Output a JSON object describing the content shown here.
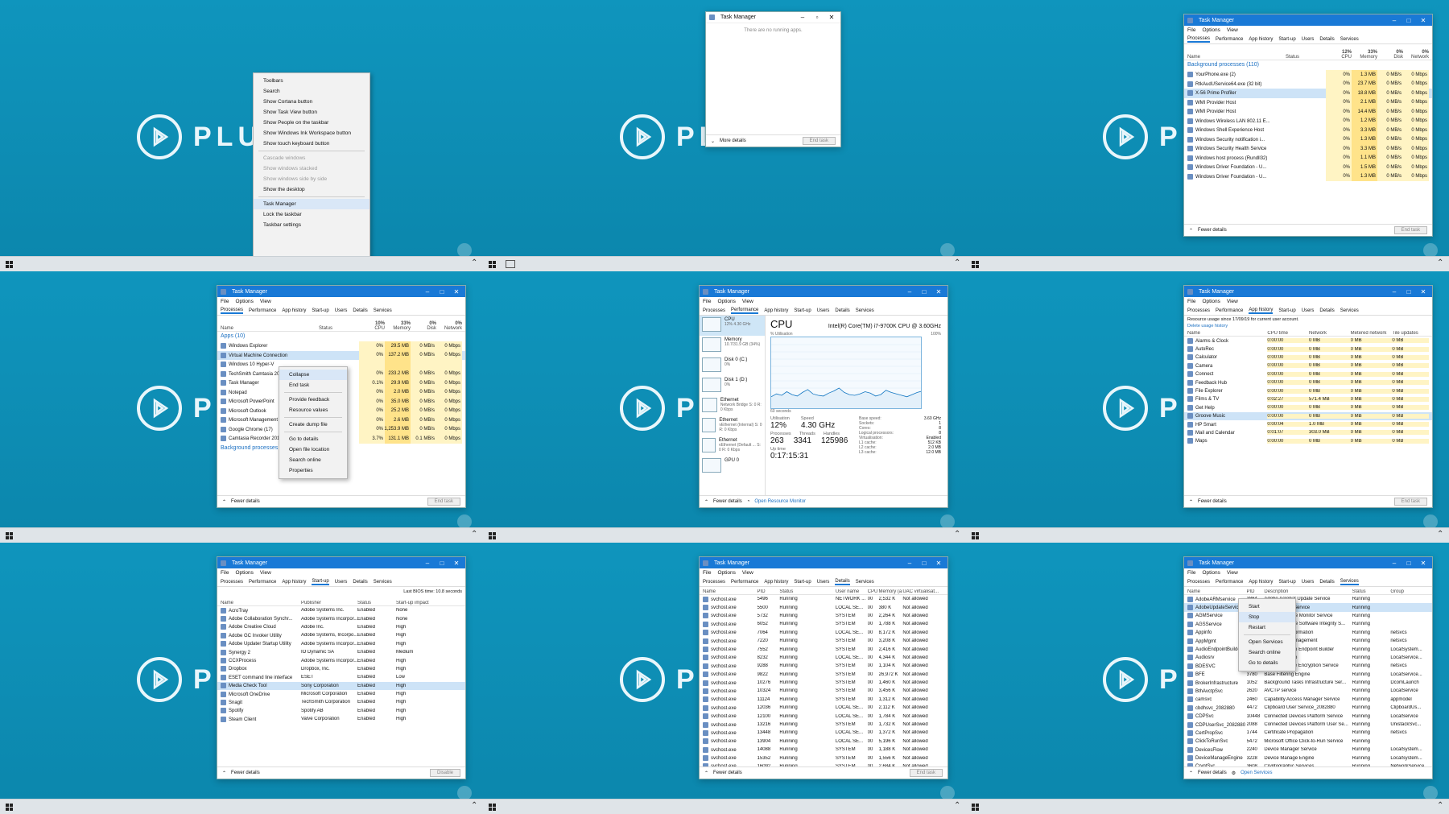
{
  "brand": {
    "text": "PLURALSIGHT",
    "short": "PL",
    "plura": "PLURA"
  },
  "taskbar_menu": {
    "items": [
      "Toolbars",
      "Search",
      "Show Cortana button",
      "Show Task View button",
      "Show People on the taskbar",
      "Show Windows Ink Workspace button",
      "Show touch keyboard button",
      "Cascade windows",
      "Show windows stacked",
      "Show windows side by side",
      "Show the desktop",
      "Task Manager",
      "Lock the taskbar",
      "Taskbar settings"
    ]
  },
  "tm_compact": {
    "title": "Task Manager",
    "empty": "There are no running apps.",
    "more": "More details",
    "end": "End task"
  },
  "tm": {
    "title": "Task Manager",
    "menu": [
      "File",
      "Options",
      "View"
    ],
    "tabs": [
      "Processes",
      "Performance",
      "App history",
      "Start-up",
      "Users",
      "Details",
      "Services"
    ],
    "fewer": "Fewer details",
    "end_task": "End task",
    "open_rm": "Open Resource Monitor",
    "open_services": "Open Services",
    "disable": "Disable"
  },
  "proc_bg": {
    "cols": {
      "name": "Name",
      "status": "Status",
      "cpu": "CPU",
      "mem": "Memory",
      "disk": "Disk",
      "net": "Network"
    },
    "pct": {
      "cpu": "12%",
      "mem": "33%",
      "disk": "0%",
      "net": "0%"
    },
    "section": "Background processes (110)",
    "rows": [
      [
        "YourPhone.exe (2)",
        "0%",
        "1.3 MB",
        "0 MB/s",
        "0 Mbps"
      ],
      [
        "RtkAudUService64.exe (32 bit)",
        "0%",
        "23.7 MB",
        "0 MB/s",
        "0 Mbps"
      ],
      [
        "X-56 Prime Profiler",
        "0%",
        "18.8 MB",
        "0 MB/s",
        "0 Mbps"
      ],
      [
        "WMI Provider Host",
        "0%",
        "2.1 MB",
        "0 MB/s",
        "0 Mbps"
      ],
      [
        "WMI Provider Host",
        "0%",
        "14.4 MB",
        "0 MB/s",
        "0 Mbps"
      ],
      [
        "Windows Wireless LAN 802.11 E...",
        "0%",
        "1.2 MB",
        "0 MB/s",
        "0 Mbps"
      ],
      [
        "Windows Shell Experience Host",
        "0%",
        "3.3 MB",
        "0 MB/s",
        "0 Mbps"
      ],
      [
        "Windows Security notification i...",
        "0%",
        "1.3 MB",
        "0 MB/s",
        "0 Mbps"
      ],
      [
        "Windows Security Health Service",
        "0%",
        "3.3 MB",
        "0 MB/s",
        "0 Mbps"
      ],
      [
        "Windows host process (Rundll32)",
        "0%",
        "1.1 MB",
        "0 MB/s",
        "0 Mbps"
      ],
      [
        "Windows Driver Foundation - U...",
        "0%",
        "1.5 MB",
        "0 MB/s",
        "0 Mbps"
      ],
      [
        "Windows Driver Foundation - U...",
        "0%",
        "1.3 MB",
        "0 MB/s",
        "0 Mbps"
      ]
    ]
  },
  "proc_apps": {
    "pct": {
      "cpu": "10%",
      "mem": "33%",
      "disk": "0%",
      "net": "0%"
    },
    "section": "Apps (10)",
    "section2": "Background processes (110)",
    "rows": [
      [
        "Windows Explorer",
        "0%",
        "29.5 MB",
        "0 MB/s",
        "0 Mbps"
      ],
      [
        "Virtual Machine Connection",
        "0%",
        "137.2 MB",
        "0 MB/s",
        "0 Mbps"
      ],
      [
        "Windows 10 Hyper-V",
        "",
        "",
        "",
        ""
      ],
      [
        "TechSmith Camtasia 2018",
        "0%",
        "233.2 MB",
        "0 MB/s",
        "0 Mbps"
      ],
      [
        "Task Manager",
        "0.1%",
        "29.9 MB",
        "0 MB/s",
        "0 Mbps"
      ],
      [
        "Notepad",
        "0%",
        "2.0 MB",
        "0 MB/s",
        "0 Mbps"
      ],
      [
        "Microsoft PowerPoint",
        "0%",
        "35.0 MB",
        "0 MB/s",
        "0 Mbps"
      ],
      [
        "Microsoft Outlook",
        "0%",
        "25.2 MB",
        "0 MB/s",
        "0 Mbps"
      ],
      [
        "Microsoft Management Console",
        "0%",
        "2.6 MB",
        "0 MB/s",
        "0 Mbps"
      ],
      [
        "Google Chrome (17)",
        "0%",
        "1,253.9 MB",
        "0 MB/s",
        "0 Mbps"
      ],
      [
        "Camtasia Recorder 2018",
        "3.7%",
        "131.1 MB",
        "0.1 MB/s",
        "0 Mbps"
      ]
    ],
    "ctx": [
      "Collapse",
      "End task",
      "Provide feedback",
      "Resource values",
      "Create dump file",
      "Go to details",
      "Open file location",
      "Search online",
      "Properties"
    ]
  },
  "perf": {
    "items": [
      {
        "name": "CPU",
        "sub": "12% 4.30 GHz"
      },
      {
        "name": "Memory",
        "sub": "10.7/31.9 GB (34%)"
      },
      {
        "name": "Disk 0 (C:)",
        "sub": "0%"
      },
      {
        "name": "Disk 1 (D:)",
        "sub": "0%"
      },
      {
        "name": "Ethernet",
        "sub": "Network Bridge S: 0 R: 0 Kbps"
      },
      {
        "name": "Ethernet",
        "sub": "vEthernet (Internal) S: 0 R: 0 Kbps"
      },
      {
        "name": "Ethernet",
        "sub": "vEthernet (Default ... S: 0 R: 0 Kbps"
      },
      {
        "name": "GPU 0",
        "sub": ""
      }
    ],
    "heading": "CPU",
    "cpu_name": "Intel(R) Core(TM) i7-9700K CPU @ 3.60GHz",
    "graph_label": "% Utilisation",
    "graph_max": "100%",
    "graph_time": "60 seconds",
    "util_label": "Utilisation",
    "util": "12%",
    "speed_label": "Speed",
    "speed": "4.30 GHz",
    "proc_label": "Processes",
    "proc": "263",
    "threads_label": "Threads",
    "threads": "3341",
    "handles_label": "Handles",
    "handles": "125986",
    "uptime_label": "Up time",
    "uptime": "0:17:15:31",
    "specs": [
      [
        "Base speed:",
        "3.60 GHz"
      ],
      [
        "Sockets:",
        "1"
      ],
      [
        "Cores:",
        "8"
      ],
      [
        "Logical processors:",
        "8"
      ],
      [
        "Virtualisation:",
        "Enabled"
      ],
      [
        "L1 cache:",
        "512 KB"
      ],
      [
        "L2 cache:",
        "2.0 MB"
      ],
      [
        "L3 cache:",
        "12.0 MB"
      ]
    ],
    "graph": [
      18,
      22,
      20,
      25,
      21,
      19,
      24,
      28,
      22,
      20,
      19,
      23,
      26,
      30,
      24,
      21,
      20,
      22,
      25,
      23,
      19,
      21,
      27,
      24,
      22,
      20,
      18,
      21,
      24,
      26
    ]
  },
  "apphist": {
    "note": "Resource usage since 17/09/19 for current user account.",
    "del": "Delete usage history",
    "cols": [
      "Name",
      "CPU time",
      "Network",
      "Metered network",
      "Tile updates"
    ],
    "rows": [
      [
        "Alarms & Clock",
        "0:00:00",
        "0 MB",
        "0 MB",
        "0 MB"
      ],
      [
        "AutoRec",
        "0:00:00",
        "0 MB",
        "0 MB",
        "0 MB"
      ],
      [
        "Calculator",
        "0:00:00",
        "0 MB",
        "0 MB",
        "0 MB"
      ],
      [
        "Camera",
        "0:00:00",
        "0 MB",
        "0 MB",
        "0 MB"
      ],
      [
        "Connect",
        "0:00:00",
        "0 MB",
        "0 MB",
        "0 MB"
      ],
      [
        "Feedback Hub",
        "0:00:00",
        "0 MB",
        "0 MB",
        "0 MB"
      ],
      [
        "File Explorer",
        "0:00:00",
        "0 MB",
        "0 MB",
        "0 MB"
      ],
      [
        "Films & TV",
        "0:02:27",
        "571.4 MB",
        "0 MB",
        "0 MB"
      ],
      [
        "Get Help",
        "0:00:00",
        "0 MB",
        "0 MB",
        "0 MB"
      ],
      [
        "Groove Music",
        "0:00:00",
        "0 MB",
        "0 MB",
        "0 MB"
      ],
      [
        "HP Smart",
        "0:00:04",
        "1.0 MB",
        "0 MB",
        "0 MB"
      ],
      [
        "Mail and Calendar",
        "0:01:07",
        "303.0 MB",
        "0 MB",
        "0 MB"
      ],
      [
        "Maps",
        "0:00:00",
        "0 MB",
        "0 MB",
        "0 MB"
      ]
    ]
  },
  "startup": {
    "note": "Last BIOS time: 10.8 seconds",
    "cols": [
      "Name",
      "Publisher",
      "Status",
      "Start-up impact"
    ],
    "rows": [
      [
        "AcroTray",
        "Adobe Systems Inc.",
        "Enabled",
        "None"
      ],
      [
        "Adobe Collaboration Synchr...",
        "Adobe Systems Incorpor...",
        "Enabled",
        "None"
      ],
      [
        "Adobe Creative Cloud",
        "Adobe Inc.",
        "Enabled",
        "High"
      ],
      [
        "Adobe GC Invoker Utility",
        "Adobe Systems, Incorpo...",
        "Enabled",
        "High"
      ],
      [
        "Adobe Updater Startup Utility",
        "Adobe Systems Incorpor...",
        "Enabled",
        "High"
      ],
      [
        "Synergy 2",
        "IO Dynamic SA",
        "Enabled",
        "Medium"
      ],
      [
        "CCXProcess",
        "Adobe Systems Incorpor...",
        "Enabled",
        "High"
      ],
      [
        "Dropbox",
        "Dropbox, Inc.",
        "Enabled",
        "High"
      ],
      [
        "ESET command line interface",
        "ESET",
        "Enabled",
        "Low"
      ],
      [
        "Media Check Tool",
        "Sony Corporation",
        "Enabled",
        "High"
      ],
      [
        "Microsoft OneDrive",
        "Microsoft Corporation",
        "Enabled",
        "High"
      ],
      [
        "Snagit",
        "TechSmith Corporation",
        "Enabled",
        "High"
      ],
      [
        "Spotify",
        "Spotify AB",
        "Enabled",
        "High"
      ],
      [
        "Steam Client",
        "Valve Corporation",
        "Enabled",
        "High"
      ]
    ]
  },
  "details": {
    "cols": [
      "Name",
      "PID",
      "Status",
      "User name",
      "CPU",
      "Memory (a...",
      "UAC virtualisat..."
    ],
    "rows": [
      [
        "svchost.exe",
        "5496",
        "Running",
        "NETWORK ...",
        "00",
        "2,532 K",
        "Not allowed"
      ],
      [
        "svchost.exe",
        "5500",
        "Running",
        "LOCAL SE...",
        "00",
        "380 K",
        "Not allowed"
      ],
      [
        "svchost.exe",
        "5732",
        "Running",
        "SYSTEM",
        "00",
        "2,264 K",
        "Not allowed"
      ],
      [
        "svchost.exe",
        "6052",
        "Running",
        "SYSTEM",
        "00",
        "1,788 K",
        "Not allowed"
      ],
      [
        "svchost.exe",
        "7064",
        "Running",
        "LOCAL SE...",
        "00",
        "8,172 K",
        "Not allowed"
      ],
      [
        "svchost.exe",
        "7220",
        "Running",
        "SYSTEM",
        "00",
        "3,208 K",
        "Not allowed"
      ],
      [
        "svchost.exe",
        "7552",
        "Running",
        "SYSTEM",
        "00",
        "2,416 K",
        "Not allowed"
      ],
      [
        "svchost.exe",
        "8232",
        "Running",
        "LOCAL SE...",
        "00",
        "4,344 K",
        "Not allowed"
      ],
      [
        "svchost.exe",
        "9288",
        "Running",
        "SYSTEM",
        "00",
        "1,104 K",
        "Not allowed"
      ],
      [
        "svchost.exe",
        "9822",
        "Running",
        "SYSTEM",
        "00",
        "26,972 K",
        "Not allowed"
      ],
      [
        "svchost.exe",
        "10276",
        "Running",
        "SYSTEM",
        "00",
        "1,460 K",
        "Not allowed"
      ],
      [
        "svchost.exe",
        "10324",
        "Running",
        "SYSTEM",
        "00",
        "3,456 K",
        "Not allowed"
      ],
      [
        "svchost.exe",
        "11124",
        "Running",
        "SYSTEM",
        "00",
        "1,312 K",
        "Not allowed"
      ],
      [
        "svchost.exe",
        "12036",
        "Running",
        "LOCAL SE...",
        "00",
        "2,112 K",
        "Not allowed"
      ],
      [
        "svchost.exe",
        "12100",
        "Running",
        "LOCAL SE...",
        "00",
        "1,784 K",
        "Not allowed"
      ],
      [
        "svchost.exe",
        "13216",
        "Running",
        "SYSTEM",
        "00",
        "1,732 K",
        "Not allowed"
      ],
      [
        "svchost.exe",
        "13448",
        "Running",
        "LOCAL SE...",
        "00",
        "1,372 K",
        "Not allowed"
      ],
      [
        "svchost.exe",
        "13904",
        "Running",
        "LOCAL SE...",
        "00",
        "5,196 K",
        "Not allowed"
      ],
      [
        "svchost.exe",
        "14088",
        "Running",
        "SYSTEM",
        "00",
        "1,188 K",
        "Not allowed"
      ],
      [
        "svchost.exe",
        "15352",
        "Running",
        "SYSTEM",
        "00",
        "1,556 K",
        "Not allowed"
      ],
      [
        "svchost.exe",
        "16092",
        "Running",
        "SYSTEM",
        "00",
        "2,684 K",
        "Not allowed"
      ],
      [
        "svchost.exe",
        "16784",
        "Running",
        "LOCAL SE...",
        "00",
        "2,124 K",
        "Not allowed"
      ]
    ]
  },
  "services": {
    "cols": [
      "Name",
      "PID",
      "Description",
      "Status",
      "Group"
    ],
    "rows": [
      [
        "AdobeARMservice",
        "3864",
        "Adobe Acrobat Update Service",
        "Running",
        ""
      ],
      [
        "AdobeUpdateService",
        "",
        "AdobeUpdateService",
        "Running",
        ""
      ],
      [
        "AGMService",
        "",
        "Adobe Genuine Monitor Service",
        "Running",
        ""
      ],
      [
        "AGSService",
        "",
        "Adobe Genuine Software Integrity S...",
        "Running",
        ""
      ],
      [
        "Appinfo",
        "",
        "Application Information",
        "Running",
        "netsvcs"
      ],
      [
        "AppMgmt",
        "",
        "Application Management",
        "Running",
        "netsvcs"
      ],
      [
        "AudioEndpointBuilder",
        "",
        "Windows Audio Endpoint Builder",
        "Running",
        "LocalSystem..."
      ],
      [
        "Audiosrv",
        "",
        "Windows Audio",
        "Running",
        "LocalService..."
      ],
      [
        "BDESVC",
        "",
        "BitLocker Drive Encryption Service",
        "Running",
        "netsvcs"
      ],
      [
        "BFE",
        "3780",
        "Base Filtering Engine",
        "Running",
        "LocalService..."
      ],
      [
        "BrokerInfrastructure",
        "1052",
        "Background Tasks Infrastructure Ser...",
        "Running",
        "DcomLaunch"
      ],
      [
        "BthAvctpSvc",
        "2620",
        "AVCTP service",
        "Running",
        "LocalService"
      ],
      [
        "camsvc",
        "2460",
        "Capability Access Manager Service",
        "Running",
        "appmodel"
      ],
      [
        "cbdhsvc_2082880",
        "4472",
        "Clipboard User Service_2082880",
        "Running",
        "ClipboardUs..."
      ],
      [
        "CDPSvc",
        "10448",
        "Connected Devices Platform Service",
        "Running",
        "LocalService"
      ],
      [
        "CDPUserSvc_2082880",
        "2088",
        "Connected Devices Platform User Se...",
        "Running",
        "UnistackSvc..."
      ],
      [
        "CertPropSvc",
        "1744",
        "Certificate Propagation",
        "Running",
        "netsvcs"
      ],
      [
        "ClickToRunSvc",
        "5472",
        "Microsoft Office Click-to-Run Service",
        "Running",
        ""
      ],
      [
        "DevicesFlow",
        "2240",
        "Device Manager Service",
        "Running",
        "LocalSystem..."
      ],
      [
        "DeviceManageEngine",
        "3228",
        "Device Manage Engine",
        "Running",
        "LocalSystem..."
      ],
      [
        "CryptSvc",
        "3608",
        "Cryptographic Services",
        "Running",
        "NetworkService"
      ]
    ],
    "ctx": [
      "Start",
      "Stop",
      "Restart",
      "Open Services",
      "Search online",
      "Go to details"
    ]
  }
}
